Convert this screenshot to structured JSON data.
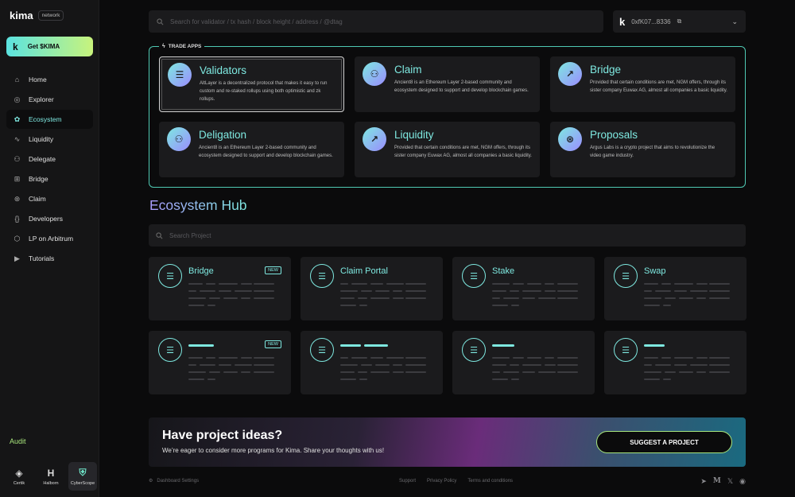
{
  "brand": {
    "name": "kima",
    "badge": "network"
  },
  "get_kima": {
    "logo": "k",
    "label": "Get $KIMA"
  },
  "nav": [
    {
      "label": "Home",
      "icon": "home-icon",
      "glyph": "⌂"
    },
    {
      "label": "Explorer",
      "icon": "globe-icon",
      "glyph": "◎"
    },
    {
      "label": "Ecosystem",
      "icon": "ecosystem-icon",
      "glyph": "✿",
      "active": true
    },
    {
      "label": "Liquidity",
      "icon": "liquidity-icon",
      "glyph": "∿"
    },
    {
      "label": "Delegate",
      "icon": "delegate-icon",
      "glyph": "⚇"
    },
    {
      "label": "Bridge",
      "icon": "bridge-icon",
      "glyph": "⊞"
    },
    {
      "label": "Claim",
      "icon": "claim-icon",
      "glyph": "⊛"
    },
    {
      "label": "Developers",
      "icon": "code-icon",
      "glyph": "{}"
    },
    {
      "label": "LP on Arbitrum",
      "icon": "arbitrum-icon",
      "glyph": "⬡"
    },
    {
      "label": "Tutorials",
      "icon": "play-icon",
      "glyph": "▶"
    }
  ],
  "audit": {
    "title": "Audit",
    "items": [
      {
        "label": "Certik",
        "glyph": "◈"
      },
      {
        "label": "Halborn",
        "glyph": "H"
      },
      {
        "label": "CyberScope",
        "glyph": "⛨",
        "selected": true
      }
    ]
  },
  "top_search": {
    "placeholder": "Search for validator / tx hash / block height / address / @dtag"
  },
  "wallet": {
    "logo": "k",
    "address": "0xfK07...8336"
  },
  "trade_apps": {
    "title": "TRADE APPS",
    "cards": [
      {
        "title": "Validators",
        "desc": "AltLayer is a decentralized protocol that makes it easy to run custom and re-staked rollups using both optimistic and zk rollups.",
        "glyph": "☰",
        "selected": true
      },
      {
        "title": "Claim",
        "desc": "Ancient8 is an Ethereum Layer 2-based community and ecosystem designed to support and develop blockchain games.",
        "glyph": "⚇"
      },
      {
        "title": "Bridge",
        "desc": "Provided that certain conditions are met, NGM offers, through its sister company Euwax AG, almost all companies a basic liquidity.",
        "glyph": "↗"
      },
      {
        "title": "Deligation",
        "desc": "Ancient8 is an Ethereum Layer 2-based community and ecosystem designed to support and develop blockchain games.",
        "glyph": "⚇"
      },
      {
        "title": "Liquidity",
        "desc": "Provided that certain conditions are met, NGM offers, through its sister company Euwax AG, almost all companies a basic liquidity.",
        "glyph": "↗"
      },
      {
        "title": "Proposals",
        "desc": "Argus Labs is a crypto project that aims to revolutionize the video game industry.",
        "glyph": "⊛"
      }
    ]
  },
  "hub": {
    "title": "Ecosystem Hub",
    "search_placeholder": "Search Project",
    "new_badge": "NEW",
    "projects": [
      {
        "title": "Bridge",
        "new": true
      },
      {
        "title": "Claim Portal",
        "new": false
      },
      {
        "title": "Stake",
        "new": false
      },
      {
        "title": "Swap",
        "new": false
      },
      {
        "title": "",
        "new": true
      },
      {
        "title": "",
        "new": false
      },
      {
        "title": "",
        "new": false
      },
      {
        "title": "",
        "new": false
      }
    ]
  },
  "banner": {
    "headline": "Have project ideas?",
    "sub": "We’re eager to consider more programs for Kima. Share your thoughts with us!",
    "cta": "SUGGEST A PROJECT"
  },
  "footer": {
    "settings": "Dashboard Settings",
    "links": [
      "Support",
      "Privacy Policy",
      "Terms and conditions"
    ],
    "social": [
      "telegram-icon",
      "medium-icon",
      "x-icon",
      "github-icon"
    ]
  },
  "colors": {
    "accent": "#7ee8e0",
    "lime": "#a8e67c",
    "violet": "#a99bff"
  }
}
